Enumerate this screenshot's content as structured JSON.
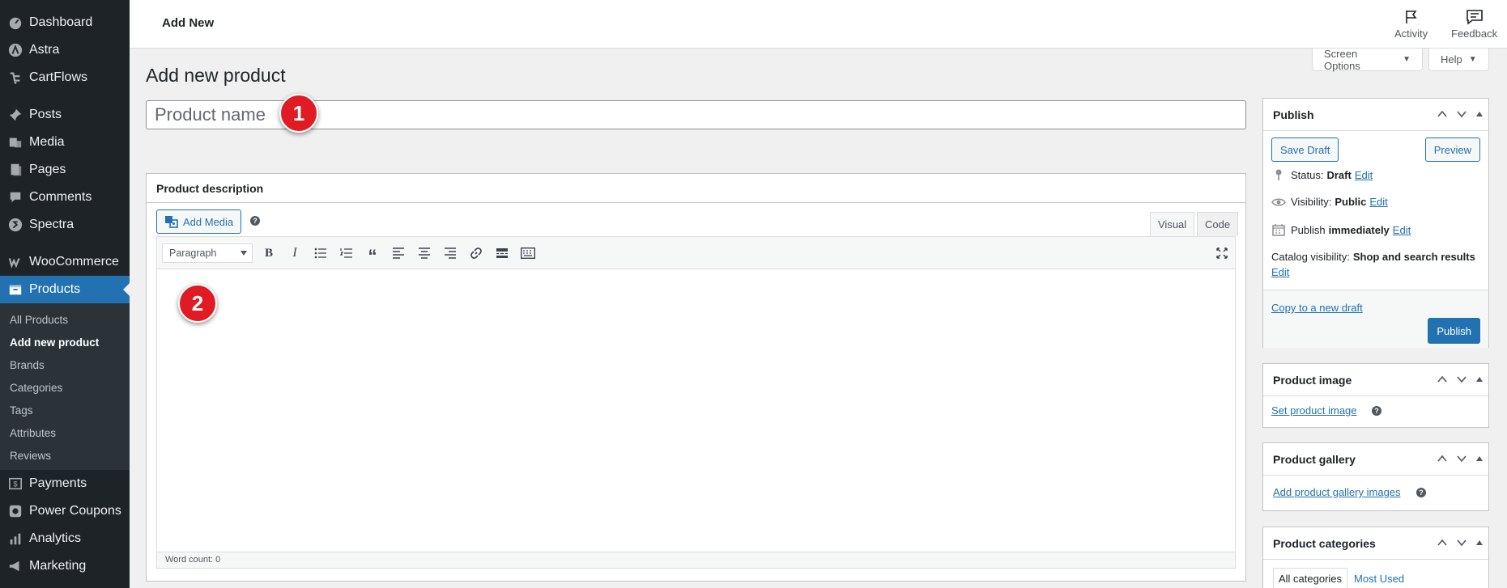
{
  "sidebar": {
    "items": [
      {
        "label": "Dashboard",
        "icon": "dashboard-icon"
      },
      {
        "label": "Astra",
        "icon": "astra-icon"
      },
      {
        "label": "CartFlows",
        "icon": "cartflows-icon"
      },
      {
        "label": "Posts",
        "icon": "pin-icon"
      },
      {
        "label": "Media",
        "icon": "media-icon"
      },
      {
        "label": "Pages",
        "icon": "pages-icon"
      },
      {
        "label": "Comments",
        "icon": "comments-icon"
      },
      {
        "label": "Spectra",
        "icon": "spectra-icon"
      },
      {
        "label": "WooCommerce",
        "icon": "woocommerce-icon"
      },
      {
        "label": "Products",
        "icon": "products-icon"
      },
      {
        "label": "Payments",
        "icon": "payments-icon"
      },
      {
        "label": "Power Coupons",
        "icon": "coupons-icon"
      },
      {
        "label": "Analytics",
        "icon": "analytics-icon"
      },
      {
        "label": "Marketing",
        "icon": "marketing-icon"
      }
    ],
    "submenu": [
      "All Products",
      "Add new product",
      "Brands",
      "Categories",
      "Tags",
      "Attributes",
      "Reviews"
    ],
    "active_item": "Products",
    "current_subitem": "Add new product"
  },
  "header": {
    "title": "Add New",
    "activity_label": "Activity",
    "feedback_label": "Feedback"
  },
  "screen_options": {
    "label": "Screen Options",
    "help_label": "Help"
  },
  "page": {
    "heading": "Add new product",
    "title_placeholder": "Product name",
    "badge1": "1",
    "badge2": "2"
  },
  "description": {
    "heading": "Product description",
    "add_media": "Add Media",
    "tab_visual": "Visual",
    "tab_code": "Code",
    "format_select": "Paragraph",
    "word_count": "Word count: 0",
    "toolbar_icons": [
      "bold-icon",
      "italic-icon",
      "bullet-list-icon",
      "numbered-list-icon",
      "blockquote-icon",
      "align-left-icon",
      "align-center-icon",
      "align-right-icon",
      "link-icon",
      "read-more-icon",
      "toolbar-toggle-icon",
      "fullscreen-icon"
    ]
  },
  "publish": {
    "heading": "Publish",
    "save_draft": "Save Draft",
    "preview": "Preview",
    "status_label": "Status:",
    "status_value": "Draft",
    "visibility_label": "Visibility:",
    "visibility_value": "Public",
    "publish_label": "Publish",
    "publish_value": "immediately",
    "edit": "Edit",
    "catalog_label": "Catalog visibility:",
    "catalog_value": "Shop and search results",
    "copy_draft": "Copy to a new draft",
    "publish_button": "Publish"
  },
  "product_image": {
    "heading": "Product image",
    "link": "Set product image"
  },
  "product_gallery": {
    "heading": "Product gallery",
    "link": "Add product gallery images"
  },
  "product_categories": {
    "heading": "Product categories",
    "tab_all": "All categories",
    "tab_used": "Most Used"
  },
  "colors": {
    "accent": "#2271b1",
    "sidebar_bg": "#1d2327",
    "badge": "#e01b24"
  }
}
